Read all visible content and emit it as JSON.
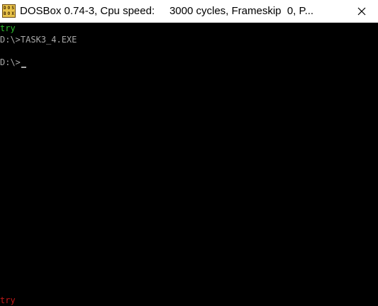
{
  "window": {
    "title": "DOSBox 0.74-3, Cpu speed:     3000 cycles, Frameskip  0, P...",
    "icon": "dosbox-icon",
    "icon_text": [
      "DOS",
      "BOX"
    ]
  },
  "console": {
    "lines": [
      {
        "text": "try",
        "color": "#2fbf2f"
      },
      {
        "text": "D:\\>TASK3_4.EXE",
        "color": "#a8a8a8"
      },
      {
        "text": "",
        "color": "#a8a8a8"
      },
      {
        "text": "D:\\>",
        "color": "#a8a8a8"
      }
    ],
    "bottom_line": {
      "text": "try",
      "color": "#c01818"
    }
  }
}
